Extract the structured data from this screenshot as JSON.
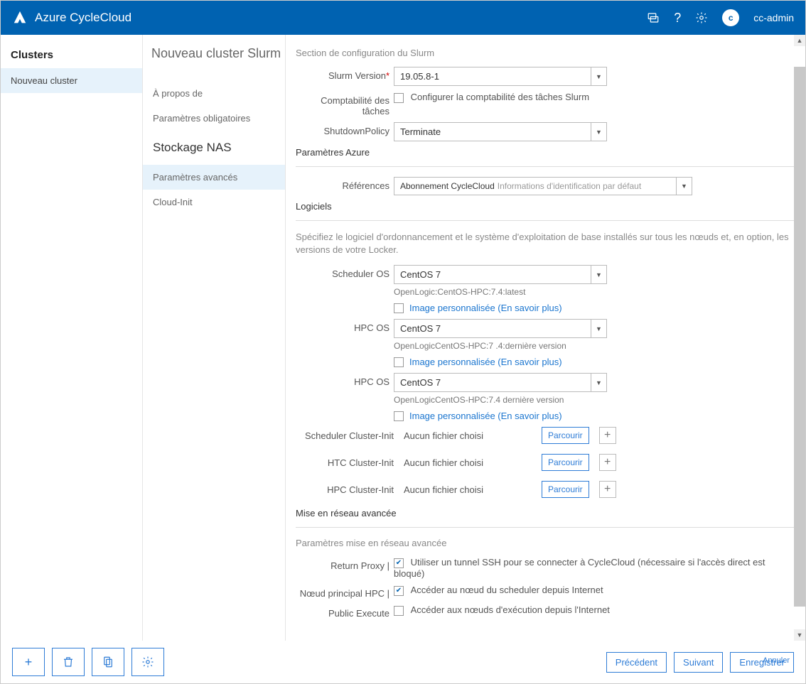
{
  "header": {
    "app_name": "Azure CycleCloud",
    "user": "cc-admin",
    "avatar_initial": "c"
  },
  "sidebar": {
    "heading": "Clusters",
    "items": [
      {
        "label": "Nouveau cluster",
        "active": true
      }
    ]
  },
  "page": {
    "title": "Nouveau cluster Slurm"
  },
  "steps": [
    {
      "label": "À propos de"
    },
    {
      "label": "Paramètres obligatoires"
    },
    {
      "label": "Stockage NAS",
      "current": true
    },
    {
      "label": "Paramètres avancés",
      "selected": true
    },
    {
      "label": "Cloud-Init"
    }
  ],
  "form": {
    "slurm_section": {
      "title": "Section de configuration du Slurm",
      "version_label": "Slurm Version",
      "version_value": "19.05.8-1",
      "accounting_label": "Comptabilité des tâches",
      "accounting_text": "Configurer la comptabilité des tâches Slurm",
      "shutdown_label": "ShutdownPolicy",
      "shutdown_value": "Terminate"
    },
    "azure_section": {
      "title": "Paramètres Azure",
      "ref_label": "Références",
      "ref_value": "Abonnement CycleCloud",
      "ref_extra": "Informations d'identification par défaut"
    },
    "software_section": {
      "title": "Logiciels",
      "description": "Spécifiez le logiciel d'ordonnancement et le système d'exploitation de base installés sur tous les nœuds et, en option, les versions de votre Locker.",
      "scheduler_os_label": "Scheduler OS",
      "scheduler_os_value": "CentOS 7",
      "scheduler_os_sub": "OpenLogic:CentOS-HPC:7.4:latest",
      "custom_image_text": "Image personnalisée (En savoir plus)",
      "hpc_os_label": "HPC OS",
      "hpc_os_value": "CentOS 7",
      "hpc_os_sub": "OpenLogicCentOS-HPC:7 .4:dernière version",
      "hpc_os2_label": "HPC OS",
      "hpc_os2_value": "CentOS 7",
      "hpc_os2_sub": "OpenLogicCentOS-HPC:7.4 dernière version"
    },
    "cluster_init": {
      "scheduler_label": "Scheduler Cluster-Init",
      "htc_label": "HTC Cluster-Init",
      "hpc_label": "HPC Cluster-Init",
      "no_file": "Aucun fichier choisi",
      "browse": "Parcourir"
    },
    "networking_section": {
      "title": "Mise en réseau avancée",
      "subtitle": "Paramètres mise en réseau avancée",
      "return_proxy_label": "Return Proxy |",
      "return_proxy_text": "Utiliser un tunnel SSH pour se connecter à CycleCloud (nécessaire si l'accès direct est bloqué)",
      "head_node_label": "Nœud principal HPC |",
      "head_node_text": "Accéder au nœud du scheduler depuis Internet",
      "public_exec_label": "Public Execute",
      "public_exec_text": "Accéder aux nœuds d'exécution depuis l'Internet"
    }
  },
  "footer": {
    "prev": "Précédent",
    "next": "Suivant",
    "save": "Enregistrer",
    "cancel": "Annuler"
  }
}
